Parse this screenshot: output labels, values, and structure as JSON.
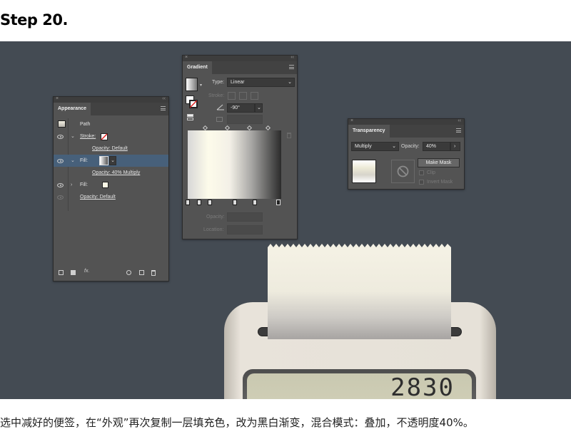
{
  "step_title": "Step 20.",
  "caption": "选中减好的便签，在“外观”再次复制一层填充色，改为黑白渐变，混合模式：叠加，不透明度40%。",
  "appearance_panel": {
    "title": "Appearance",
    "rows": {
      "path": "Path",
      "stroke": "Stroke:",
      "stroke_opacity": "Opacity: Default",
      "fill1": "Fill:",
      "fill1_opacity": "Opacity: 40% Multiply",
      "fill2": "Fill:",
      "opacity": "Opacity: Default"
    },
    "footer_fx": "fx."
  },
  "gradient_panel": {
    "title": "Gradient",
    "type_label": "Type:",
    "type_value": "Linear",
    "stroke_label": "Stroke:",
    "angle_value": "-90°",
    "opacity_label": "Opacity:",
    "location_label": "Location:"
  },
  "transparency_panel": {
    "title": "Transparency",
    "blend_mode": "Multiply",
    "opacity_label": "Opacity:",
    "opacity_value": "40%",
    "make_mask": "Make Mask",
    "clip": "Clip",
    "invert_mask": "Invert Mask"
  },
  "artwork": {
    "display_value": "2830"
  },
  "colors": {
    "canvas_bg": "#444b53",
    "panel_bg": "#535353",
    "selected_row": "#47607a"
  }
}
